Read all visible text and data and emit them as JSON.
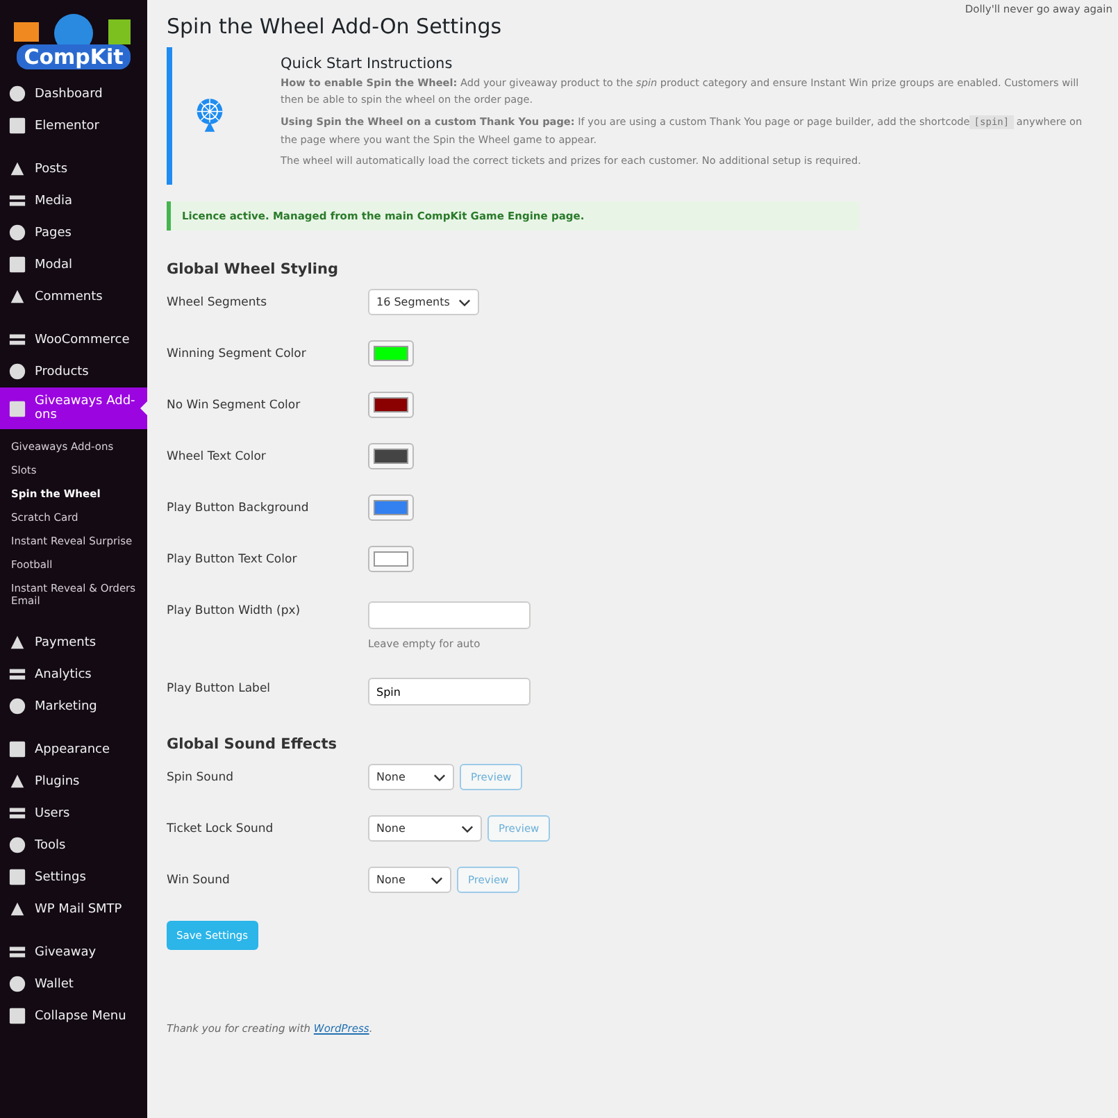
{
  "sidebar": {
    "logo": {
      "text": "CompKit"
    },
    "groups": [
      [
        {
          "label": "Dashboard",
          "selected": false
        },
        {
          "label": "Elementor",
          "selected": false
        }
      ],
      [
        {
          "label": "Posts",
          "selected": false
        },
        {
          "label": "Media",
          "selected": false
        },
        {
          "label": "Pages",
          "selected": false
        },
        {
          "label": "Modal",
          "selected": false
        },
        {
          "label": "Comments",
          "selected": false
        }
      ],
      [
        {
          "label": "WooCommerce",
          "selected": false
        },
        {
          "label": "Products",
          "selected": false
        },
        {
          "label": "Giveaways Add-ons",
          "selected": true,
          "submenu": [
            {
              "label": "Giveaways Add-ons",
              "selected": false
            },
            {
              "label": "Slots",
              "selected": false
            },
            {
              "label": "Spin the Wheel",
              "selected": true
            },
            {
              "label": "Scratch Card",
              "selected": false
            },
            {
              "label": "Instant Reveal Surprise",
              "selected": false
            },
            {
              "label": "Football",
              "selected": false
            },
            {
              "label": "Instant Reveal & Orders Email",
              "selected": false
            }
          ]
        }
      ],
      [
        {
          "label": "Payments",
          "selected": false
        },
        {
          "label": "Analytics",
          "selected": false
        },
        {
          "label": "Marketing",
          "selected": false
        }
      ],
      [
        {
          "label": "Appearance",
          "selected": false
        },
        {
          "label": "Plugins",
          "selected": false
        },
        {
          "label": "Users",
          "selected": false
        },
        {
          "label": "Tools",
          "selected": false
        },
        {
          "label": "Settings",
          "selected": false
        },
        {
          "label": "WP Mail SMTP",
          "selected": false
        }
      ],
      [
        {
          "label": "Giveaway",
          "selected": false
        },
        {
          "label": "Wallet",
          "selected": false
        },
        {
          "label": "Collapse Menu",
          "selected": false
        }
      ]
    ]
  },
  "top_note": "Dolly'll never go away again",
  "page_title": "Spin the Wheel Add-On Settings",
  "instructions": {
    "title": "Quick Start Instructions",
    "paragraphs": [
      {
        "text": "**How to enable Spin the Wheel:** Add your giveaway product to the *spin* product category and ensure Instant Win prize groups are enabled. Customers will then be able to spin the wheel on the order page."
      },
      {
        "text": "**Using Spin the Wheel on a custom Thank You page:** If you are using a custom Thank You page or page builder, add the shortcode",
        "code": "[spin]",
        "after": "anywhere on the page where you want the Spin the Wheel game to appear."
      },
      {
        "text": "The wheel will automatically load the correct tickets and prizes for each customer. No additional setup is required."
      }
    ]
  },
  "notice": "Licence active. Managed from the main CompKit Game Engine page.",
  "sections": [
    {
      "title": "Global Wheel Styling",
      "fields": [
        {
          "kind": "select",
          "label": "Wheel Segments",
          "value": "16 Segments"
        },
        {
          "kind": "color",
          "label": "Winning Segment Color",
          "color": "#00ff00"
        },
        {
          "kind": "color",
          "label": "No Win Segment Color",
          "color": "#8b0000"
        },
        {
          "kind": "color",
          "label": "Wheel Text Color",
          "color": "#444444"
        },
        {
          "kind": "color",
          "label": "Play Button Background",
          "color": "#3380f0"
        },
        {
          "kind": "color",
          "label": "Play Button Text Color",
          "color": "#ffffff"
        },
        {
          "kind": "text",
          "label": "Play Button Width (px)",
          "hint": "Leave empty for auto"
        },
        {
          "kind": "text",
          "label": "Play Button Label",
          "value": "Spin"
        }
      ]
    },
    {
      "title": "Global Sound Effects",
      "fields": [
        {
          "kind": "sound",
          "label": "Spin Sound",
          "value": "None",
          "button": "Preview"
        },
        {
          "kind": "sound",
          "label": "Ticket Lock Sound",
          "value": "None",
          "button": "Preview"
        },
        {
          "kind": "sound",
          "label": "Win Sound",
          "value": "None",
          "button": "Preview"
        }
      ]
    }
  ],
  "save_button": "Save Settings",
  "footer": {
    "text": "Thank you for creating with",
    "link": "WordPress",
    "after": "."
  }
}
